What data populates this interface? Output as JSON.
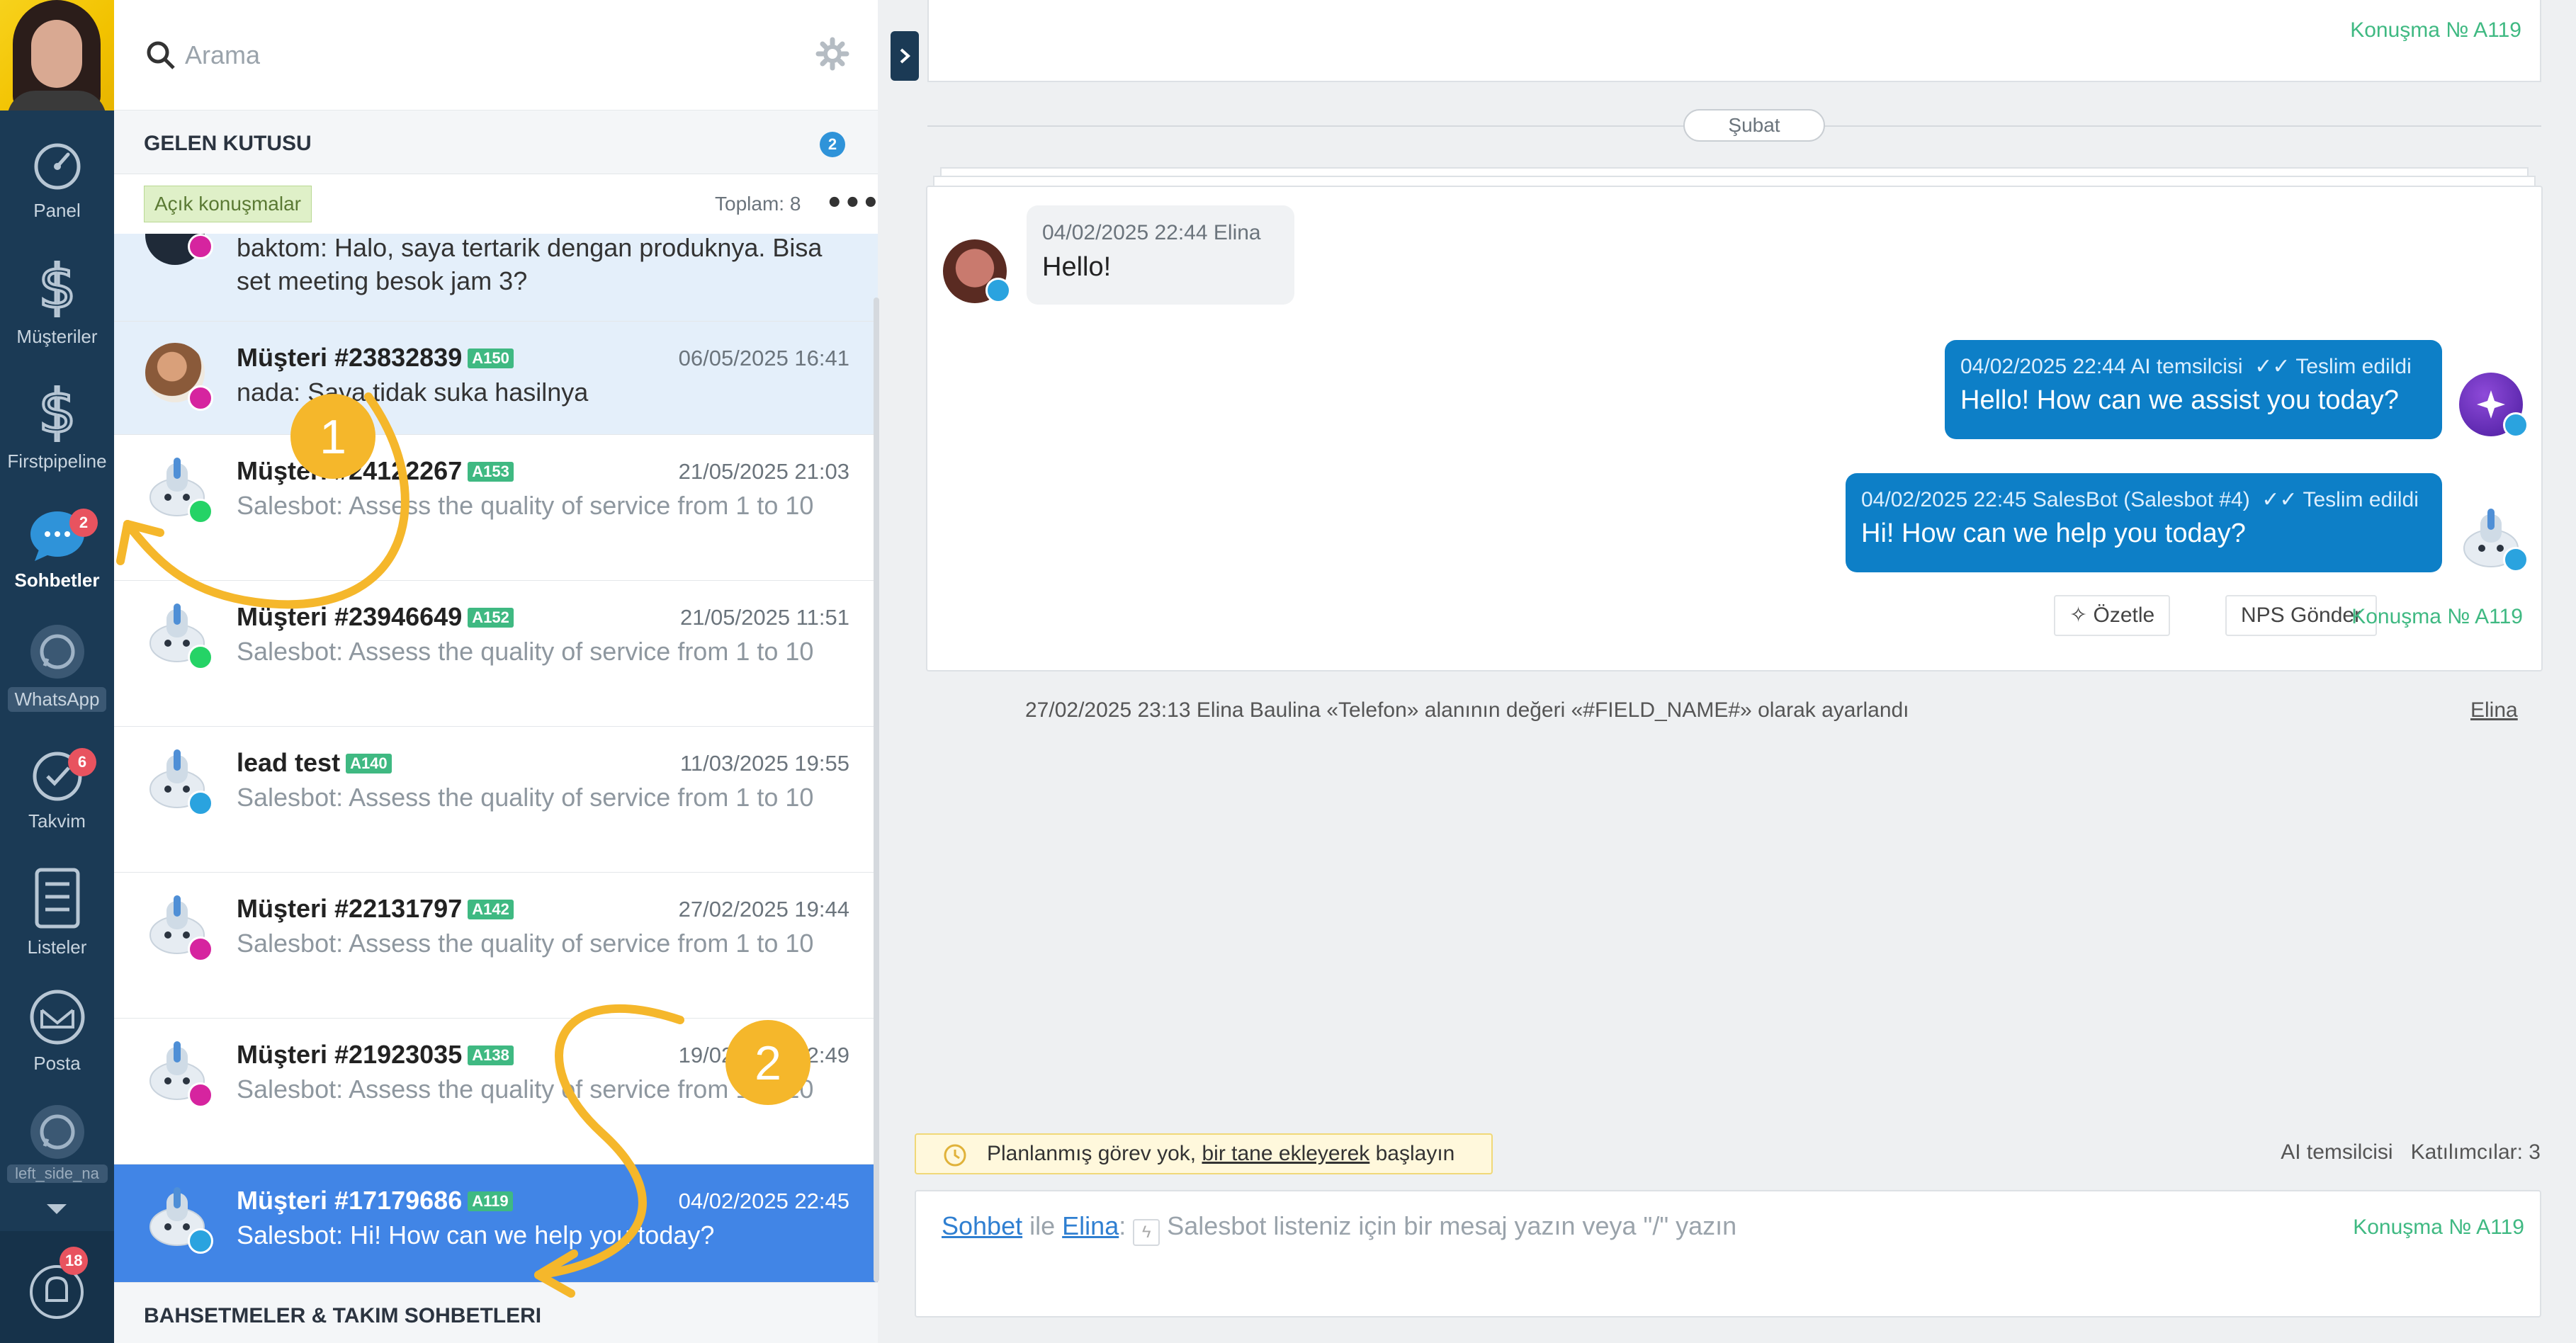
{
  "nav": {
    "items": [
      {
        "label": "Panel",
        "icon": "gauge-icon"
      },
      {
        "label": "Müşteriler",
        "icon": "dollar-icon"
      },
      {
        "label": "Firstpipeline",
        "icon": "dollar-icon"
      },
      {
        "label": "Sohbetler",
        "icon": "chat-icon",
        "badge": "2",
        "active": true
      },
      {
        "label": "WhatsApp",
        "icon": "whatsapp-icon"
      },
      {
        "label": "Takvim",
        "icon": "check-circle-icon",
        "badge": "6"
      },
      {
        "label": "Listeler",
        "icon": "list-icon"
      },
      {
        "label": "Posta",
        "icon": "mail-icon"
      },
      {
        "label": "left_side_na",
        "icon": "whatsapp-icon"
      }
    ],
    "notifications_badge": "18"
  },
  "inbox": {
    "search_placeholder": "Arama",
    "header_title": "GELEN KUTUSU",
    "header_count": "2",
    "filter_tag": "Açık konuşmalar",
    "total": "Toplam: 8",
    "more": "•••",
    "mentions_title": "BAHSETMELER & TAKIM SOHBETLERI",
    "conversations": [
      {
        "name": "",
        "tag": "",
        "time": "",
        "message": "baktom: Halo, saya tertarik dengan produknya. Bisa set meeting besok jam 3?",
        "channel": "instagram"
      },
      {
        "name": "Müşteri #23832839",
        "tag": "A150",
        "time": "06/05/2025 16:41",
        "message": "nada: Saya tidak suka hasilnya",
        "channel": "instagram"
      },
      {
        "name": "Müşteri #24122267",
        "tag": "A153",
        "time": "21/05/2025 21:03",
        "message": "Salesbot: Assess the quality of service from 1 to 10",
        "channel": "whatsapp"
      },
      {
        "name": "Müşteri #23946649",
        "tag": "A152",
        "time": "21/05/2025 11:51",
        "message": "Salesbot: Assess the quality of service from 1 to 10",
        "channel": "whatsapp"
      },
      {
        "name": "lead test",
        "tag": "A140",
        "time": "11/03/2025 19:55",
        "message": "Salesbot: Assess the quality of service from 1 to 10",
        "channel": "telegram"
      },
      {
        "name": "Müşteri #22131797",
        "tag": "A142",
        "time": "27/02/2025 19:44",
        "message": "Salesbot: Assess the quality of service from 1 to 10",
        "channel": "instagram"
      },
      {
        "name": "Müşteri #21923035",
        "tag": "A138",
        "time": "19/02/2025 12:49",
        "message": "Salesbot: Assess the quality of service from 1 to 10",
        "channel": "instagram"
      },
      {
        "name": "Müşteri #17179686",
        "tag": "A119",
        "time": "04/02/2025 22:45",
        "message": "Salesbot: Hi! How can we help you today?",
        "channel": "telegram"
      }
    ]
  },
  "chat": {
    "conversation_no": "Konuşma № A119",
    "date_divider": "Şubat",
    "messages": [
      {
        "meta": "04/02/2025 22:44 Elina",
        "text": "Hello!"
      },
      {
        "meta": "04/02/2025 22:44 AI temsilcisi",
        "status": "Teslim edildi",
        "text": "Hello! How can we assist you today?"
      },
      {
        "meta": "04/02/2025 22:45 SalesBot (Salesbot #4)",
        "status": "Teslim edildi",
        "text": "Hi! How can we help you today?"
      }
    ],
    "summarize_button": "Özetle",
    "nps_button": "NPS Gönder",
    "event_text": "27/02/2025 23:13 Elina Baulina «Telefon» alanının değeri «#FIELD_NAME#» olarak ayarlandı",
    "event_user": "Elina",
    "tasks": {
      "before": "Planlanmış görev yok, ",
      "link": "bir tane ekleyerek",
      "after": " başlayın"
    },
    "participants": {
      "agent": "AI temsilcisi",
      "count": "Katılımcılar: 3"
    },
    "composer": {
      "mode": "Sohbet",
      "joiner": "ile",
      "target": "Elina",
      "placeholder": "Salesbot listeniz için bir mesaj yazın veya \"/\" yazın"
    }
  },
  "annotations": {
    "step1": "1",
    "step2": "2"
  },
  "colors": {
    "nav_bg": "#1b3a55",
    "accent": "#4185e6",
    "bubble_out": "#0d7fc7",
    "tag_green": "#3fb982",
    "annotation": "#f5b72b"
  }
}
